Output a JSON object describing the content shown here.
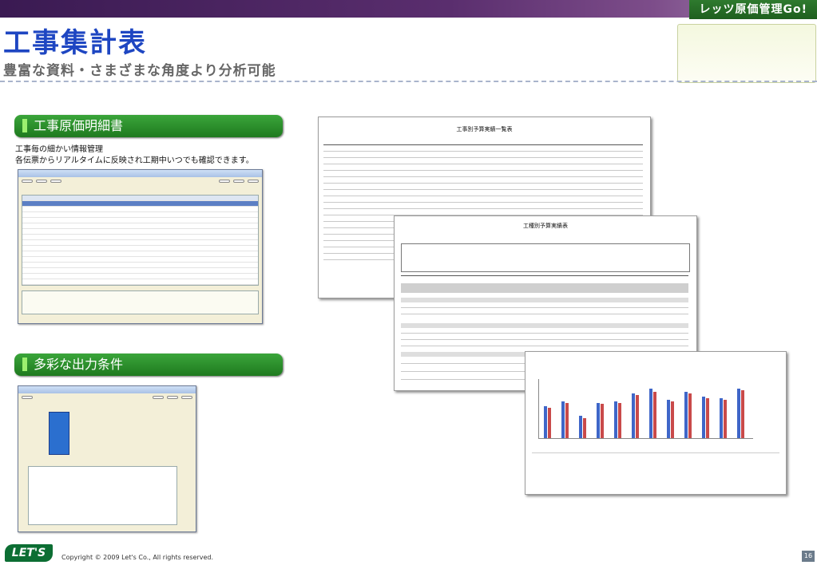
{
  "header": {
    "brand": "レッツ原価管理Go!",
    "title": "工事集計表",
    "subtitle": "豊富な資料・さまざまな角度より分析可能"
  },
  "section1": {
    "heading": "工事原価明細書",
    "desc1": "工事毎の細かい情報管理",
    "desc2": "各伝票からリアルタイムに反映され工期中いつでも確認できます。"
  },
  "section2": {
    "heading": "多彩な出力条件"
  },
  "reports": {
    "report1_title": "工事別予算実績一覧表",
    "report2_title": "工種別予算実績表"
  },
  "footer": {
    "logo": "LET'S",
    "copyright": "Copyright © 2009 Let's Co., All rights reserved.",
    "page": "16"
  },
  "colors": {
    "title_blue": "#1e46c2",
    "pill_green": "#2d8f2d",
    "chart_red": "#c94a4a",
    "chart_blue": "#3f66c8"
  }
}
